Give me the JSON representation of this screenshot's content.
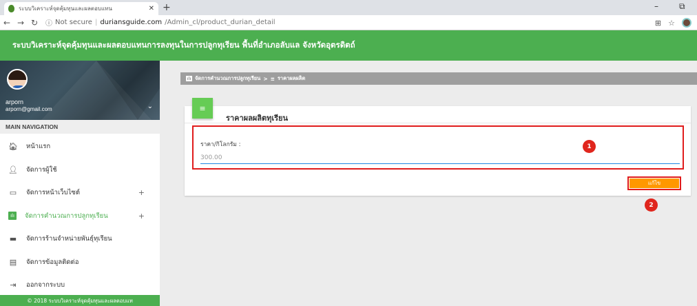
{
  "browser": {
    "tab_title": "ระบบวิเคราะห์จุดคุ้มทุนและผลตอบแทน",
    "not_secure": "Not secure",
    "host": "duriansguide.com",
    "path": "/Admin_cl/product_durian_detail",
    "icons": [
      "back-icon",
      "forward-icon",
      "reload-icon",
      "info-icon",
      "translate-icon",
      "star-icon"
    ]
  },
  "header": {
    "title": "ระบบวิเคราะห์จุดคุ้มทุนและผลตอบแทนการลงทุนในการปลูกทุเรียน พื้นที่อำเภอลับแล จังหวัดอุตรดิตถ์"
  },
  "user": {
    "name": "arporn",
    "email": "arporn@gmail.com"
  },
  "sidebar": {
    "section": "MAIN NAVIGATION",
    "items": [
      {
        "label": "หน้าแรก",
        "icon": "home-icon"
      },
      {
        "label": "จัดการผู้ใช้",
        "icon": "user-icon"
      },
      {
        "label": "จัดการหน้าเว็บไซต์",
        "icon": "web-icon"
      },
      {
        "label": "จัดการคำนวณการปลูกทุเรียน",
        "icon": "chart-icon"
      },
      {
        "label": "จัดการร้านจำหน่ายพันธุ์ทุเรียน",
        "icon": "store-icon"
      },
      {
        "label": "จัดการข้อมูลติดต่อ",
        "icon": "contact-icon"
      },
      {
        "label": "ออกจากระบบ",
        "icon": "logout-icon"
      }
    ],
    "footer": "© 2018 ระบบวิเคราะห์จุดคุ้มทุนและผลตอบแท"
  },
  "breadcrumb": {
    "parent": "จัดการคำนวณการปลูกทุเรียน",
    "separator": ">",
    "current": "ราคาผลผลิต"
  },
  "card": {
    "title": "ราคาผลผลิตทุเรียน",
    "field_label": "ราคา/กิโลกรัม :",
    "field_value": "300.00",
    "button_label": "แก้ไข",
    "markers": [
      "1",
      "2"
    ]
  }
}
